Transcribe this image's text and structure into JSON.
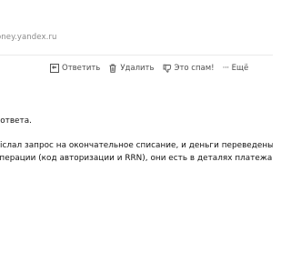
{
  "message": {
    "sender_email": "oney.yandex.ru"
  },
  "toolbar": {
    "reply_label": "Ответить",
    "delete_label": "Удалить",
    "spam_label": "Это спам!",
    "more_label": "Ещё"
  },
  "body": {
    "lines": [
      "идание ответа.",
      "іслал запрос на окончательное списание, и деньги переведены. Рекомен",
      "операции (код авторизации и RRN), они есть в деталях платежа."
    ]
  },
  "icons": {
    "reply": "reply-icon",
    "delete": "trash-icon",
    "spam": "thumbs-down-icon",
    "more": "dots-icon"
  }
}
